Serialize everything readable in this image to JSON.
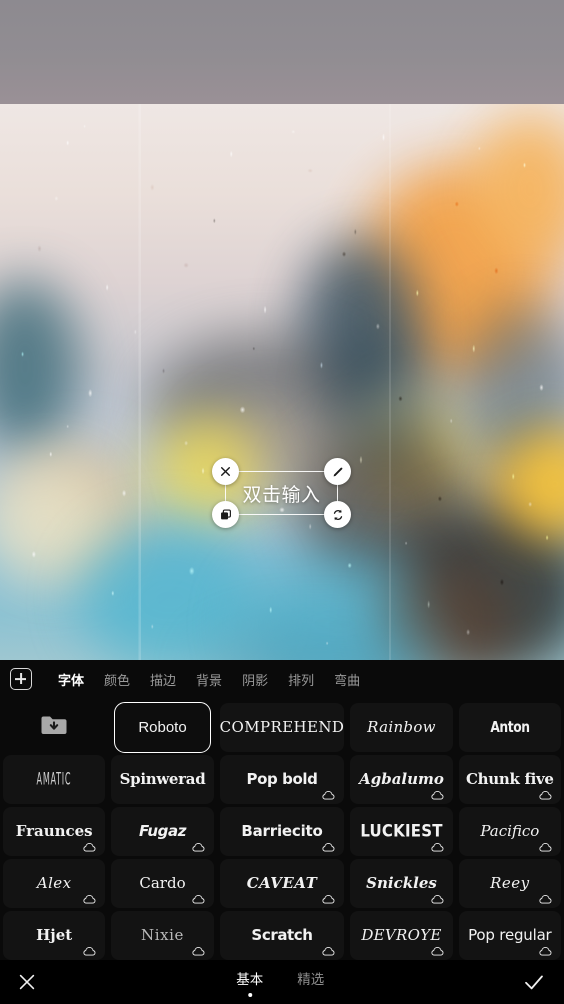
{
  "canvas": {
    "text_object": {
      "text": "双击输入",
      "handles": {
        "delete": "close-icon",
        "edit": "pencil-icon",
        "duplicate": "layers-copy-icon",
        "rotate": "rotate-resize-icon"
      }
    }
  },
  "toolbar": {
    "add_label": "add-layer-icon",
    "tabs": [
      {
        "label": "字体",
        "active": true
      },
      {
        "label": "颜色",
        "active": false
      },
      {
        "label": "描边",
        "active": false
      },
      {
        "label": "背景",
        "active": false
      },
      {
        "label": "阴影",
        "active": false
      },
      {
        "label": "排列",
        "active": false
      },
      {
        "label": "弯曲",
        "active": false
      }
    ]
  },
  "font_grid": {
    "items": [
      {
        "name": "my-fonts-folder",
        "label": "",
        "icon": "folder-download-icon",
        "selected": false,
        "cloud": false,
        "style": ""
      },
      {
        "name": "Roboto",
        "label": "Roboto",
        "selected": true,
        "cloud": false,
        "style": "f-roboto"
      },
      {
        "name": "Comprehend",
        "label": "COMPREHEND",
        "selected": false,
        "cloud": false,
        "style": "f-serifcap"
      },
      {
        "name": "Rainbow",
        "label": "Rainbow",
        "selected": false,
        "cloud": false,
        "style": "f-script"
      },
      {
        "name": "Anton",
        "label": "Anton",
        "selected": false,
        "cloud": false,
        "style": "f-anton"
      },
      {
        "name": "Amatic",
        "label": "AMATIC",
        "selected": false,
        "cloud": false,
        "style": "f-amatic"
      },
      {
        "name": "Spinwerad",
        "label": "Spinwerad",
        "selected": false,
        "cloud": false,
        "style": "f-spin"
      },
      {
        "name": "Pop bold",
        "label": "Pop bold",
        "selected": false,
        "cloud": true,
        "style": "f-popbold"
      },
      {
        "name": "Agbalumo",
        "label": "Agbalumo",
        "selected": false,
        "cloud": true,
        "style": "f-agba"
      },
      {
        "name": "Chunk five",
        "label": "Chunk five",
        "selected": false,
        "cloud": true,
        "style": "f-chunk"
      },
      {
        "name": "Fraunces",
        "label": "Fraunces",
        "selected": false,
        "cloud": true,
        "style": "f-fraunces"
      },
      {
        "name": "Fugaz",
        "label": "Fugaz",
        "selected": false,
        "cloud": true,
        "style": "f-fugaz"
      },
      {
        "name": "Barriecito",
        "label": "Barriecito",
        "selected": false,
        "cloud": true,
        "style": "f-barrie"
      },
      {
        "name": "Luckiest",
        "label": "LUCKIEST",
        "selected": false,
        "cloud": true,
        "style": "f-luckiest"
      },
      {
        "name": "Pacifico",
        "label": "Pacifico",
        "selected": false,
        "cloud": true,
        "style": "f-pacifico"
      },
      {
        "name": "Alex",
        "label": "Alex",
        "selected": false,
        "cloud": true,
        "style": "f-alex"
      },
      {
        "name": "Cardo",
        "label": "Cardo",
        "selected": false,
        "cloud": true,
        "style": "f-cardo"
      },
      {
        "name": "Caveat",
        "label": "CAVEAT",
        "selected": false,
        "cloud": true,
        "style": "f-caveat"
      },
      {
        "name": "Snickles",
        "label": "Snickles",
        "selected": false,
        "cloud": true,
        "style": "f-snickles"
      },
      {
        "name": "Reey",
        "label": "Reey",
        "selected": false,
        "cloud": true,
        "style": "f-reey"
      },
      {
        "name": "Hjet",
        "label": "Hjet",
        "selected": false,
        "cloud": true,
        "style": "f-hjet"
      },
      {
        "name": "Nixie",
        "label": "Nixie",
        "selected": false,
        "cloud": true,
        "style": "f-nixie"
      },
      {
        "name": "Scratch",
        "label": "Scratch",
        "selected": false,
        "cloud": true,
        "style": "f-scratch"
      },
      {
        "name": "Devroye",
        "label": "DEVROYE",
        "selected": false,
        "cloud": true,
        "style": "f-devroye"
      },
      {
        "name": "Pop regular",
        "label": "Pop regular",
        "selected": false,
        "cloud": true,
        "style": "f-popreg"
      }
    ]
  },
  "bottom_bar": {
    "close_icon": "close-icon",
    "done_icon": "check-icon",
    "tabs": [
      {
        "label": "基本",
        "active": true
      },
      {
        "label": "精选",
        "active": false
      }
    ]
  },
  "colors": {
    "panel_bg": "#0a0a0a",
    "cell_bg": "#131313",
    "accent": "#ffffff",
    "inactive_text": "#9b9b9b"
  }
}
